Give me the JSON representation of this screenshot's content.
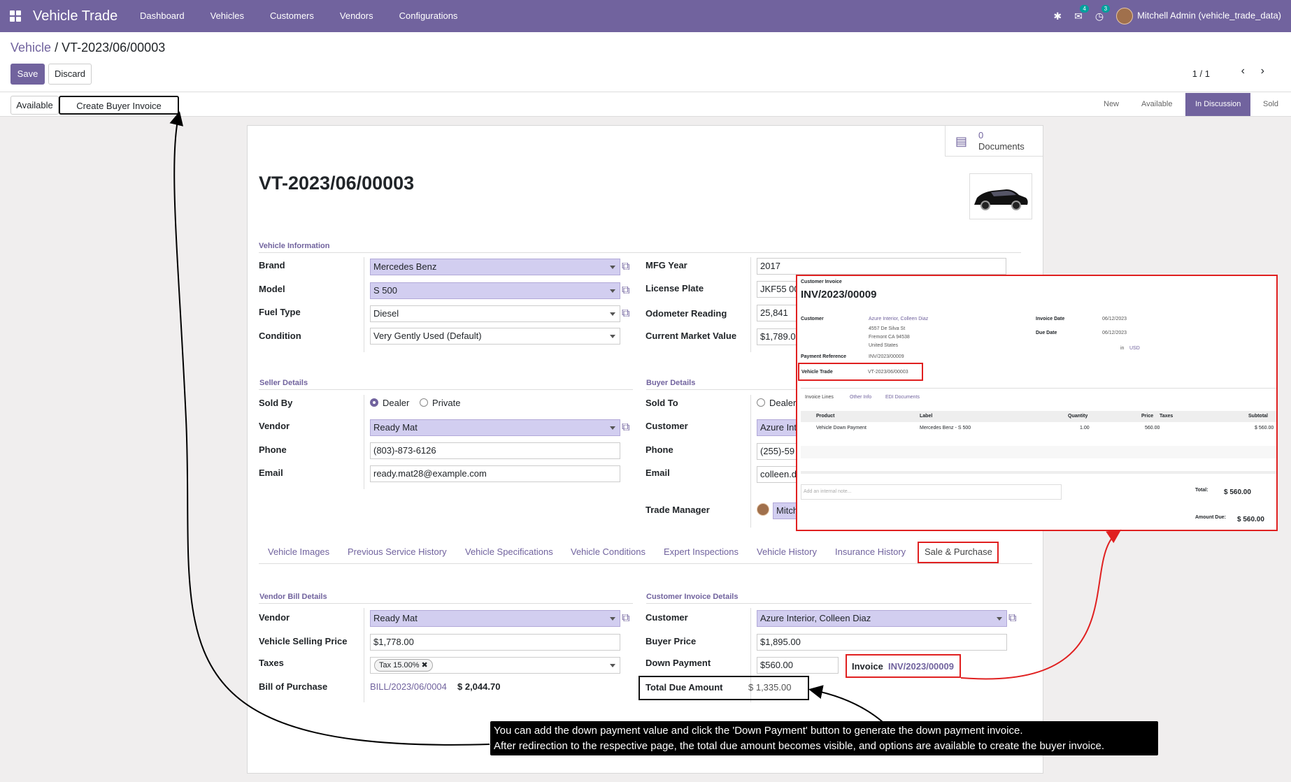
{
  "navbar": {
    "app_name": "Vehicle Trade",
    "menu": [
      "Dashboard",
      "Vehicles",
      "Customers",
      "Vendors",
      "Configurations"
    ],
    "messages_badge": "4",
    "activity_badge": "3",
    "user": "Mitchell Admin (vehicle_trade_data)"
  },
  "breadcrumb": {
    "parent": "Vehicle",
    "separator": "/",
    "current": "VT-2023/06/00003"
  },
  "buttons": {
    "save": "Save",
    "discard": "Discard",
    "available": "Available",
    "create_buyer_invoice": "Create Buyer Invoice"
  },
  "pager": {
    "value": "1 / 1",
    "prev": "‹",
    "next": "›"
  },
  "stages": [
    "New",
    "Available",
    "In Discussion",
    "Sold"
  ],
  "active_stage": "In Discussion",
  "documents": {
    "count": "0",
    "label": "Documents"
  },
  "record_title": "VT-2023/06/00003",
  "vehicle_info": {
    "section": "Vehicle Information",
    "brand_label": "Brand",
    "brand": "Mercedes Benz",
    "model_label": "Model",
    "model": "S 500",
    "fuel_label": "Fuel Type",
    "fuel": "Diesel",
    "condition_label": "Condition",
    "condition": "Very Gently Used (Default)",
    "mfg_label": "MFG Year",
    "mfg": "2017",
    "plate_label": "License Plate",
    "plate": "JKF55 00",
    "odo_label": "Odometer Reading",
    "odo": "25,841",
    "cmv_label": "Current Market Value",
    "cmv": "$1,789.0"
  },
  "seller": {
    "section": "Seller Details",
    "sold_by_label": "Sold By",
    "opt_dealer": "Dealer",
    "opt_private": "Private",
    "vendor_label": "Vendor",
    "vendor": "Ready Mat",
    "phone_label": "Phone",
    "phone": "(803)-873-6126",
    "email_label": "Email",
    "email": "ready.mat28@example.com"
  },
  "buyer": {
    "section": "Buyer Details",
    "sold_to_label": "Sold To",
    "opt_dealer": "Dealer",
    "customer_label": "Customer",
    "customer": "Azure Int",
    "phone_label": "Phone",
    "phone": "(255)-59",
    "email_label": "Email",
    "email": "colleen.d",
    "manager_label": "Trade Manager",
    "manager": "Mitch"
  },
  "tabs": [
    "Vehicle Images",
    "Previous Service History",
    "Vehicle Specifications",
    "Vehicle Conditions",
    "Expert Inspections",
    "Vehicle History",
    "Insurance History",
    "Sale & Purchase"
  ],
  "vendor_bill": {
    "section": "Vendor Bill Details",
    "vendor_label": "Vendor",
    "vendor": "Ready Mat",
    "price_label": "Vehicle Selling Price",
    "price": "$1,778.00",
    "taxes_label": "Taxes",
    "tax": "Tax 15.00%",
    "bill_label": "Bill of Purchase",
    "bill": "BILL/2023/06/0004",
    "bill_amount": "$ 2,044.70"
  },
  "customer_invoice": {
    "section": "Customer Invoice Details",
    "customer_label": "Customer",
    "customer": "Azure Interior, Colleen Diaz",
    "buyer_price_label": "Buyer Price",
    "buyer_price": "$1,895.00",
    "down_label": "Down Payment",
    "down": "$560.00",
    "invoice_label": "Invoice",
    "invoice": "INV/2023/00009",
    "due_label": "Total Due Amount",
    "due": "$ 1,335.00"
  },
  "popup": {
    "kind": "Customer Invoice",
    "number": "INV/2023/00009",
    "customer_label": "Customer",
    "customer": "Azure Interior, Colleen Diaz",
    "addr1": "4557 De Silva St",
    "addr2": "Fremont CA 94538",
    "addr3": "United States",
    "payref_label": "Payment Reference",
    "payref": "INV/2023/00009",
    "vt_label": "Vehicle Trade",
    "vt": "VT-2023/06/00003",
    "inv_date_label": "Invoice Date",
    "inv_date": "06/12/2023",
    "due_date_label": "Due Date",
    "due_date": "06/12/2023",
    "currency_prefix": "in",
    "currency": "USD",
    "tabs": [
      "Invoice Lines",
      "Other Info",
      "EDI Documents"
    ],
    "cols": [
      "Product",
      "Label",
      "Quantity",
      "Price",
      "Taxes",
      "Subtotal"
    ],
    "row": {
      "product": "Vehicle Down Payment",
      "label": "Mercedes Benz - S 500",
      "qty": "1.00",
      "price": "560.00",
      "taxes": "",
      "subtotal": "$ 560.00"
    },
    "note_placeholder": "Add an internal note...",
    "total_label": "Total:",
    "total": "$ 560.00",
    "amount_due_label": "Amount Due:",
    "amount_due": "$ 560.00"
  },
  "annotation": {
    "line1": "You can add the down payment value and click the 'Down Payment' button to generate the down payment invoice.",
    "line2": "After redirection to the respective page, the total due amount becomes visible, and options are available to create the buyer invoice."
  },
  "colors": {
    "brand": "#71639e",
    "highlight_red": "#e02020",
    "required_field": "#d2cef0"
  }
}
